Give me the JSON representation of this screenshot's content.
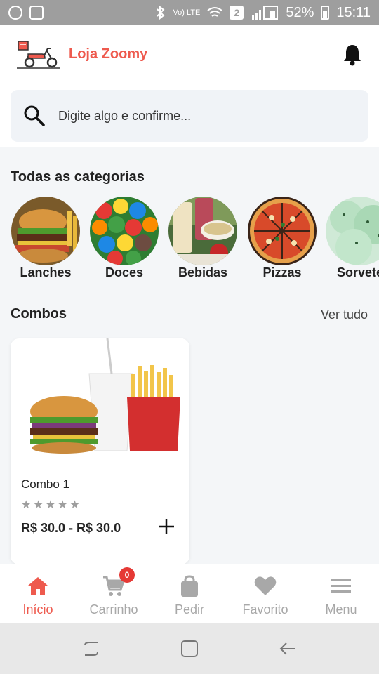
{
  "status_bar": {
    "battery": "52%",
    "time": "15:11",
    "volte": "Vo) LTE",
    "sim_slot": "2",
    "icons": [
      "whatsapp-icon",
      "gallery-icon",
      "bluetooth-icon",
      "wifi-icon",
      "signal-icon",
      "battery-icon"
    ]
  },
  "header": {
    "brand": "Loja Zoomy",
    "logo": "scooter-delivery-logo",
    "notification_icon": "bell-icon"
  },
  "search": {
    "placeholder": "Digite algo e confirme...",
    "icon": "search-icon"
  },
  "categories": {
    "title": "Todas as categorias",
    "items": [
      {
        "label": "Lanches",
        "image": "burger-photo"
      },
      {
        "label": "Doces",
        "image": "candy-photo"
      },
      {
        "label": "Bebidas",
        "image": "drinks-photo"
      },
      {
        "label": "Pizzas",
        "image": "pizza-photo"
      },
      {
        "label": "Sorvete",
        "image": "ice-cream-photo"
      }
    ]
  },
  "combos": {
    "title": "Combos",
    "see_all": "Ver tudo",
    "products": [
      {
        "name": "Combo 1",
        "rating": 0,
        "max_rating": 5,
        "price": "R$ 30.0 - R$ 30.0",
        "image": "burger-fries-soda-photo"
      }
    ]
  },
  "bottom_nav": {
    "items": [
      {
        "label": "Início",
        "icon": "home-icon",
        "active": true
      },
      {
        "label": "Carrinho",
        "icon": "cart-icon",
        "badge": "0"
      },
      {
        "label": "Pedir",
        "icon": "shopping-bag-icon"
      },
      {
        "label": "Favorito",
        "icon": "heart-icon"
      },
      {
        "label": "Menu",
        "icon": "menu-icon"
      }
    ]
  },
  "colors": {
    "accent": "#ee5a4e",
    "badge": "#e53935",
    "status_bar": "#9e9e9e",
    "page_bg": "#f4f6f8"
  }
}
